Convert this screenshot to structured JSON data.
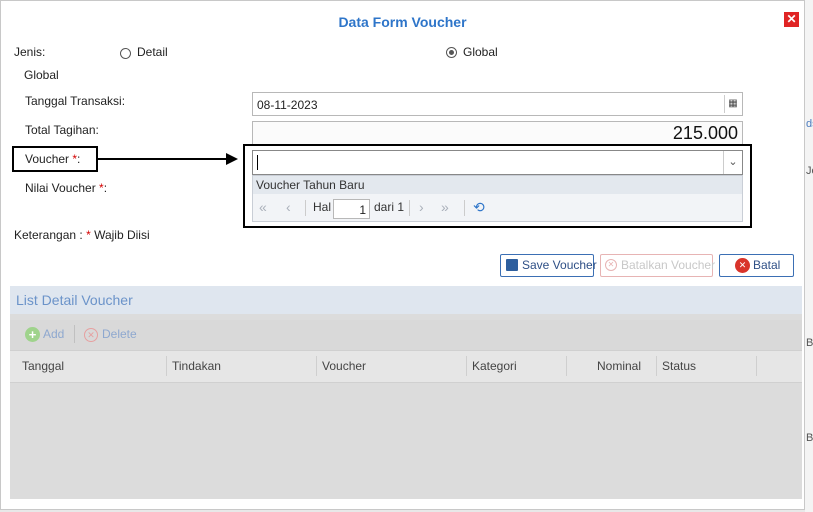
{
  "dialog": {
    "title": "Data Form Voucher",
    "close_glyph": "✕"
  },
  "form": {
    "jenis_label": "Jenis:",
    "jenis_options": [
      {
        "label": "Detail",
        "selected": false
      },
      {
        "label": "Global",
        "selected": true
      }
    ],
    "jenis_value": "Global",
    "tanggal_label": "Tanggal Transaksi:",
    "tanggal_value": "08-11-2023",
    "total_label": "Total Tagihan:",
    "total_value": "215.000",
    "voucher_label": "Voucher ",
    "voucher_required": "*",
    "voucher_colon": ":",
    "voucher_value": "",
    "nilai_label": "Nilai Voucher ",
    "nilai_required": "*",
    "nilai_colon": ":",
    "keterangan_label": "Keterangan : ",
    "keterangan_required": "*",
    "keterangan_text": " Wajib Diisi"
  },
  "dropdown": {
    "items": [
      "Voucher Tahun Baru"
    ],
    "pager": {
      "hal_label": "Hal",
      "page": "1",
      "dari_label": "dari 1"
    }
  },
  "buttons": {
    "save": "Save Voucher",
    "cancel_voucher": "Batalkan Voucher",
    "close": "Batal"
  },
  "list": {
    "title": "List Detail Voucher",
    "add_label": "Add",
    "delete_label": "Delete",
    "columns": [
      "Tanggal",
      "Tindakan",
      "Voucher",
      "Kategori",
      "Nominal",
      "Status"
    ]
  },
  "background": {
    "fragments": [
      "ds",
      "Je",
      "Bl",
      "Bl"
    ]
  },
  "colors": {
    "accent": "#2e75c9",
    "close": "#e02424",
    "required": "#d40000"
  }
}
